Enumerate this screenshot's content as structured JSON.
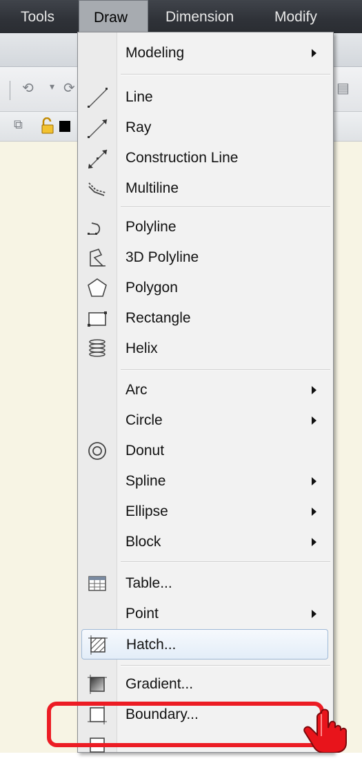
{
  "menubar": {
    "items": [
      "Tools",
      "Draw",
      "Dimension",
      "Modify"
    ],
    "active": "Draw"
  },
  "draw_menu": {
    "items": [
      {
        "label": "Modeling",
        "icon": "none",
        "submenu": true
      },
      {
        "label": "Line",
        "icon": "line-icon",
        "submenu": false
      },
      {
        "label": "Ray",
        "icon": "ray-icon",
        "submenu": false
      },
      {
        "label": "Construction Line",
        "icon": "construction-line-icon",
        "submenu": false
      },
      {
        "label": "Multiline",
        "icon": "multiline-icon",
        "submenu": false
      },
      {
        "label": "Polyline",
        "icon": "polyline-icon",
        "submenu": false
      },
      {
        "label": "3D Polyline",
        "icon": "3d-polyline-icon",
        "submenu": false
      },
      {
        "label": "Polygon",
        "icon": "polygon-icon",
        "submenu": false
      },
      {
        "label": "Rectangle",
        "icon": "rectangle-icon",
        "submenu": false
      },
      {
        "label": "Helix",
        "icon": "helix-icon",
        "submenu": false
      },
      {
        "label": "Arc",
        "icon": "none",
        "submenu": true
      },
      {
        "label": "Circle",
        "icon": "none",
        "submenu": true
      },
      {
        "label": "Donut",
        "icon": "donut-icon",
        "submenu": false
      },
      {
        "label": "Spline",
        "icon": "none",
        "submenu": true
      },
      {
        "label": "Ellipse",
        "icon": "none",
        "submenu": true
      },
      {
        "label": "Block",
        "icon": "none",
        "submenu": true
      },
      {
        "label": "Table...",
        "icon": "table-icon",
        "submenu": false
      },
      {
        "label": "Point",
        "icon": "none",
        "submenu": true
      },
      {
        "label": "Hatch...",
        "icon": "hatch-icon",
        "submenu": false,
        "hovered": true
      },
      {
        "label": "Gradient...",
        "icon": "gradient-icon",
        "submenu": false,
        "highlighted_by_callout": true
      },
      {
        "label": "Boundary...",
        "icon": "boundary-icon",
        "submenu": false
      }
    ]
  },
  "colors": {
    "menubar_bg": "#2f3238",
    "menu_bg": "#f2f2f2",
    "hover_border": "#9fb9d6",
    "callout_red": "#ec1c24",
    "canvas_bg": "#f7f4e4"
  }
}
